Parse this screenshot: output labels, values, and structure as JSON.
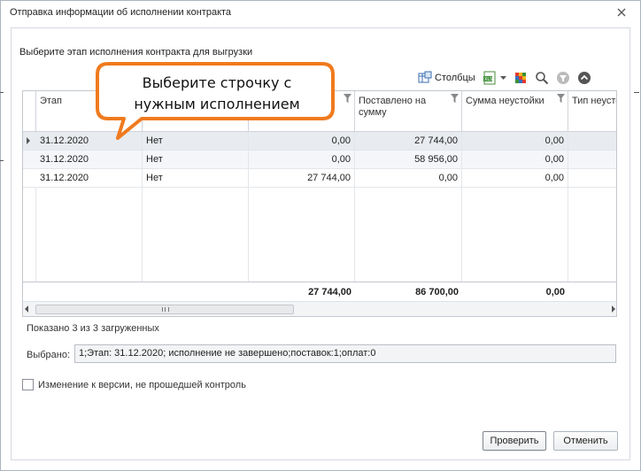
{
  "window": {
    "title": "Отправка информации об исполнении контракта"
  },
  "instruction": "Выберите этап исполнения контракта для выгрузки",
  "toolbar": {
    "columns_label": "Столбцы"
  },
  "grid": {
    "columns": [
      "Этап",
      "",
      "",
      "Поставлено на сумму",
      "Сумма неустойки",
      "Тип неусто"
    ],
    "rows": [
      [
        "31.12.2020",
        "Нет",
        "0,00",
        "27 744,00",
        "0,00"
      ],
      [
        "31.12.2020",
        "Нет",
        "0,00",
        "58 956,00",
        "0,00"
      ],
      [
        "31.12.2020",
        "Нет",
        "27 744,00",
        "0,00",
        "0,00"
      ]
    ],
    "totals": [
      "27 744,00",
      "86 700,00",
      "0,00"
    ]
  },
  "shown_text": "Показано 3 из 3 загруженных",
  "selected": {
    "label": "Выбрано:",
    "value": "1;Этап: 31.12.2020; исполнение не завершено;поставок:1;оплат:0"
  },
  "checkbox": {
    "label": "Изменение к версии, не прошедшей контроль"
  },
  "buttons": {
    "check": "Проверить",
    "cancel": "Отменить"
  },
  "callout": {
    "line1": "Выберите строчку с",
    "line2": "нужным исполнением"
  },
  "colors": {
    "callout_border": "#f07a1e",
    "selected_row": "#e8ebef"
  }
}
